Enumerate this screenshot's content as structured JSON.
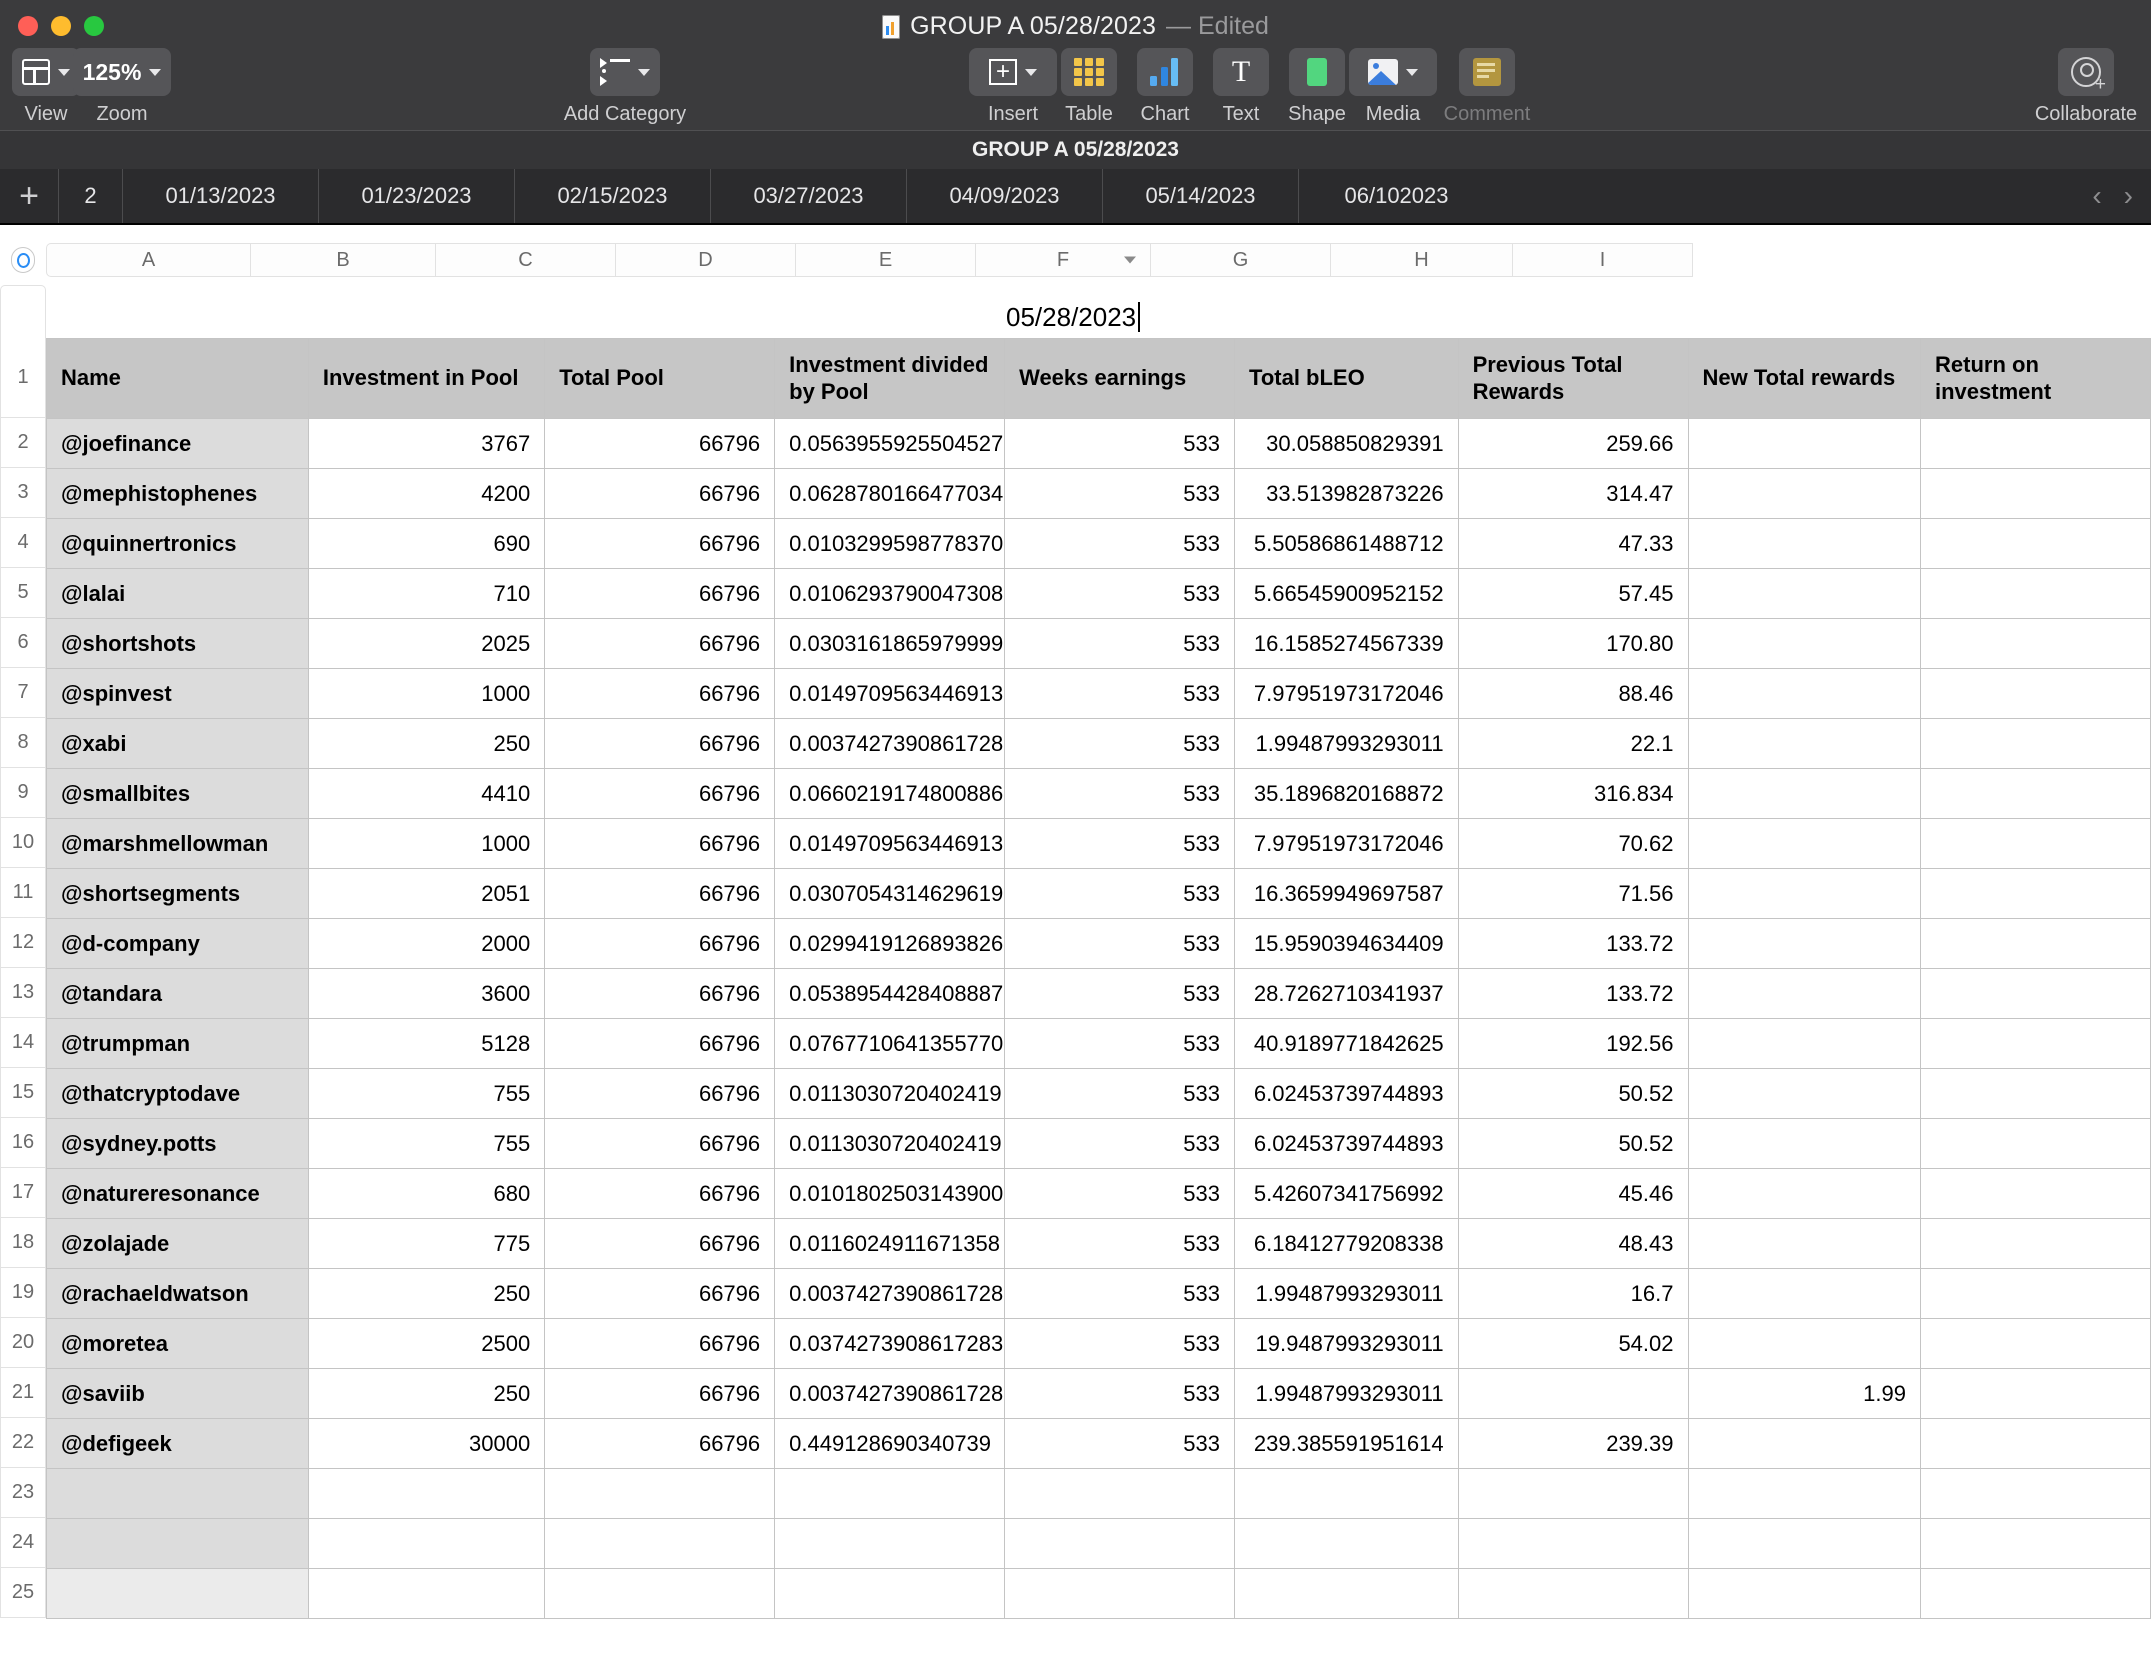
{
  "window": {
    "title": "GROUP A 05/28/2023",
    "edited_badge": "— Edited",
    "doc_icon": "numbers-doc-icon"
  },
  "toolbar": {
    "view": {
      "label": "View",
      "icon": "view-panel-icon"
    },
    "zoom": {
      "label": "Zoom",
      "value": "125%"
    },
    "add_category": {
      "label": "Add Category",
      "icon": "category-list-icon"
    },
    "insert": {
      "label": "Insert",
      "icon": "insert-cell-icon"
    },
    "table": {
      "label": "Table",
      "icon": "table-grid-icon"
    },
    "chart": {
      "label": "Chart",
      "icon": "bar-chart-icon"
    },
    "text": {
      "label": "Text",
      "icon": "text-t-icon"
    },
    "shape": {
      "label": "Shape",
      "icon": "shape-rect-icon"
    },
    "media": {
      "label": "Media",
      "icon": "media-photo-icon"
    },
    "comment": {
      "label": "Comment",
      "icon": "comment-note-icon"
    },
    "collaborate": {
      "label": "Collaborate",
      "icon": "collaborate-person-add-icon"
    }
  },
  "sheet_strip": {
    "title": "GROUP A 05/28/2023"
  },
  "tabs": {
    "add_label": "+",
    "items": [
      {
        "label": "2",
        "partial": true
      },
      {
        "label": "01/13/2023",
        "partial": false
      },
      {
        "label": "01/23/2023",
        "partial": false
      },
      {
        "label": "02/15/2023",
        "partial": false
      },
      {
        "label": "03/27/2023",
        "partial": false
      },
      {
        "label": "04/09/2023",
        "partial": false
      },
      {
        "label": "05/14/2023",
        "partial": false
      },
      {
        "label": "06/102023",
        "partial": false
      }
    ],
    "prev_arrow": "‹",
    "next_arrow": "›"
  },
  "grid": {
    "column_letters": [
      "A",
      "B",
      "C",
      "D",
      "E",
      "F",
      "G",
      "H",
      "I"
    ],
    "column_with_chevron": "F",
    "row_numbers": [
      "1",
      "2",
      "3",
      "4",
      "5",
      "6",
      "7",
      "8",
      "9",
      "10",
      "11",
      "12",
      "13",
      "14",
      "15",
      "16",
      "17",
      "18",
      "19",
      "20",
      "21",
      "22",
      "23",
      "24",
      "25"
    ]
  },
  "sheet_title_cell": "05/28/2023",
  "table": {
    "headers": [
      "Name",
      "Investment in Pool",
      "Total Pool",
      "Investment divided by Pool",
      "Weeks earnings",
      "Total bLEO",
      "Previous Total Rewards",
      "New Total rewards",
      "Return on investment"
    ],
    "rows": [
      {
        "name": "@joefinance",
        "investment": "3767",
        "pool": "66796",
        "divided": "0.0563955925504527",
        "weeks": "533",
        "bleo": "30.058850829391",
        "prev": "259.66",
        "new": "",
        "roi": ""
      },
      {
        "name": "@mephistophenes",
        "investment": "4200",
        "pool": "66796",
        "divided": "0.0628780166477034",
        "weeks": "533",
        "bleo": "33.513982873226",
        "prev": "314.47",
        "new": "",
        "roi": ""
      },
      {
        "name": "@quinnertronics",
        "investment": "690",
        "pool": "66796",
        "divided": "0.0103299598778370",
        "weeks": "533",
        "bleo": "5.50586861488712",
        "prev": "47.33",
        "new": "",
        "roi": ""
      },
      {
        "name": "@lalai",
        "investment": "710",
        "pool": "66796",
        "divided": "0.0106293790047308",
        "weeks": "533",
        "bleo": "5.66545900952152",
        "prev": "57.45",
        "new": "",
        "roi": ""
      },
      {
        "name": "@shortshots",
        "investment": "2025",
        "pool": "66796",
        "divided": "0.0303161865979999",
        "weeks": "533",
        "bleo": "16.1585274567339",
        "prev": "170.80",
        "new": "",
        "roi": ""
      },
      {
        "name": "@spinvest",
        "investment": "1000",
        "pool": "66796",
        "divided": "0.0149709563446913",
        "weeks": "533",
        "bleo": "7.97951973172046",
        "prev": "88.46",
        "new": "",
        "roi": ""
      },
      {
        "name": "@xabi",
        "investment": "250",
        "pool": "66796",
        "divided": "0.0037427390861728",
        "weeks": "533",
        "bleo": "1.99487993293011",
        "prev": "22.1",
        "new": "",
        "roi": ""
      },
      {
        "name": "@smallbites",
        "investment": "4410",
        "pool": "66796",
        "divided": "0.0660219174800886",
        "weeks": "533",
        "bleo": "35.1896820168872",
        "prev": "316.834",
        "new": "",
        "roi": ""
      },
      {
        "name": "@marshmellowman",
        "investment": "1000",
        "pool": "66796",
        "divided": "0.0149709563446913",
        "weeks": "533",
        "bleo": "7.97951973172046",
        "prev": "70.62",
        "new": "",
        "roi": ""
      },
      {
        "name": "@shortsegments",
        "investment": "2051",
        "pool": "66796",
        "divided": "0.0307054314629619",
        "weeks": "533",
        "bleo": "16.3659949697587",
        "prev": "71.56",
        "new": "",
        "roi": ""
      },
      {
        "name": "@d-company",
        "investment": "2000",
        "pool": "66796",
        "divided": "0.0299419126893826",
        "weeks": "533",
        "bleo": "15.9590394634409",
        "prev": "133.72",
        "new": "",
        "roi": ""
      },
      {
        "name": "@tandara",
        "investment": "3600",
        "pool": "66796",
        "divided": "0.0538954428408887",
        "weeks": "533",
        "bleo": "28.7262710341937",
        "prev": "133.72",
        "new": "",
        "roi": ""
      },
      {
        "name": "@trumpman",
        "investment": "5128",
        "pool": "66796",
        "divided": "0.0767710641355770",
        "weeks": "533",
        "bleo": "40.9189771842625",
        "prev": "192.56",
        "new": "",
        "roi": ""
      },
      {
        "name": "@thatcryptodave",
        "investment": "755",
        "pool": "66796",
        "divided": "0.0113030720402419",
        "weeks": "533",
        "bleo": "6.02453739744893",
        "prev": "50.52",
        "new": "",
        "roi": ""
      },
      {
        "name": "@sydney.potts",
        "investment": "755",
        "pool": "66796",
        "divided": "0.0113030720402419",
        "weeks": "533",
        "bleo": "6.02453739744893",
        "prev": "50.52",
        "new": "",
        "roi": ""
      },
      {
        "name": "@natureresonance",
        "investment": "680",
        "pool": "66796",
        "divided": "0.0101802503143900",
        "weeks": "533",
        "bleo": "5.42607341756992",
        "prev": "45.46",
        "new": "",
        "roi": ""
      },
      {
        "name": "@zolajade",
        "investment": "775",
        "pool": "66796",
        "divided": "0.0116024911671358",
        "weeks": "533",
        "bleo": "6.18412779208338",
        "prev": "48.43",
        "new": "",
        "roi": ""
      },
      {
        "name": "@rachaeldwatson",
        "investment": "250",
        "pool": "66796",
        "divided": "0.0037427390861728",
        "weeks": "533",
        "bleo": "1.99487993293011",
        "prev": "16.7",
        "new": "",
        "roi": ""
      },
      {
        "name": "@moretea",
        "investment": "2500",
        "pool": "66796",
        "divided": "0.0374273908617283",
        "weeks": "533",
        "bleo": "19.9487993293011",
        "prev": "54.02",
        "new": "",
        "roi": ""
      },
      {
        "name": "@saviib",
        "investment": "250",
        "pool": "66796",
        "divided": "0.0037427390861728",
        "weeks": "533",
        "bleo": "1.99487993293011",
        "prev": "",
        "new": "1.99",
        "roi": ""
      },
      {
        "name": "@defigeek",
        "investment": "30000",
        "pool": "66796",
        "divided": "0.449128690340739",
        "weeks": "533",
        "bleo": "239.385591951614",
        "prev": "239.39",
        "new": "",
        "roi": ""
      }
    ],
    "empty_rows": 3
  },
  "colors": {
    "toolbar_bg": "#3b3b3d",
    "tab_bar_bg": "#2b2b2d",
    "header_cell_bg": "#c6c6c6",
    "name_cell_bg": "#dcdcdc",
    "accent_blue": "#2a8df5"
  }
}
